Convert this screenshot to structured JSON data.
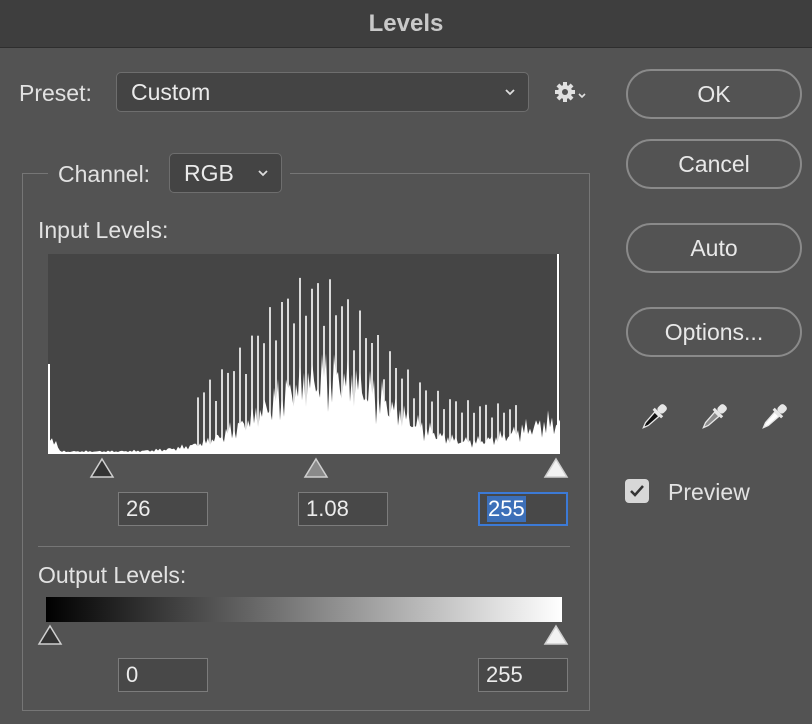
{
  "window": {
    "title": "Levels"
  },
  "preset": {
    "label": "Preset:",
    "value": "Custom"
  },
  "channel": {
    "label": "Channel:",
    "value": "RGB"
  },
  "input_levels": {
    "label": "Input Levels:",
    "black": "26",
    "gamma": "1.08",
    "white": "255",
    "black_value": 26,
    "gamma_position": 0.525,
    "white_value": 255
  },
  "output_levels": {
    "label": "Output Levels:",
    "black": "0",
    "white": "255",
    "black_value": 0,
    "white_value": 255
  },
  "buttons": {
    "ok": "OK",
    "cancel": "Cancel",
    "auto": "Auto",
    "options": "Options..."
  },
  "preview": {
    "label": "Preview",
    "checked": true
  },
  "icons": {
    "settings": "gear-icon",
    "black_eyedropper": "eyedropper-black-icon",
    "gray_eyedropper": "eyedropper-gray-icon",
    "white_eyedropper": "eyedropper-white-icon"
  },
  "colors": {
    "dialog_bg": "#535353",
    "focus_border": "#3c7ad6",
    "histogram_bg": "#454545",
    "histogram_fill": "#ffffff"
  }
}
